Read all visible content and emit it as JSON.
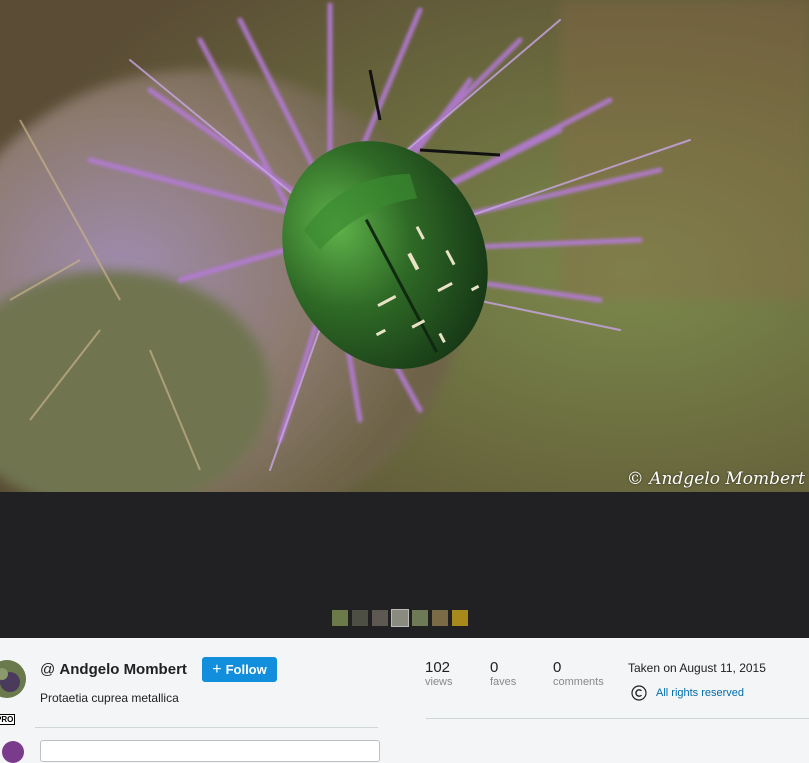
{
  "photo": {
    "watermark": "© Andgelo Mombert"
  },
  "filmstrip": {
    "thumbnails": [
      {
        "color": "#6c7a4a"
      },
      {
        "color": "#4d4f44"
      },
      {
        "color": "#5e5852"
      },
      {
        "color": "#8a8a7e",
        "active": true
      },
      {
        "color": "#6d7a55"
      },
      {
        "color": "#7a6a45"
      },
      {
        "color": "#a88a1c"
      }
    ]
  },
  "owner": {
    "at_symbol": "@",
    "name": "Andgelo Mombert",
    "pro_badge": "PRO",
    "follow_label": "Follow"
  },
  "photo_info": {
    "title": "Protaetia cuprea metallica"
  },
  "stats": {
    "views": {
      "value": "102",
      "label": "views"
    },
    "faves": {
      "value": "0",
      "label": "faves"
    },
    "comments": {
      "value": "0",
      "label": "comments"
    }
  },
  "meta": {
    "taken": "Taken on August 11, 2015",
    "rights": "All rights reserved"
  },
  "colors": {
    "accent": "#128fdc",
    "link": "#006dac",
    "viewer_background": "#212124"
  }
}
